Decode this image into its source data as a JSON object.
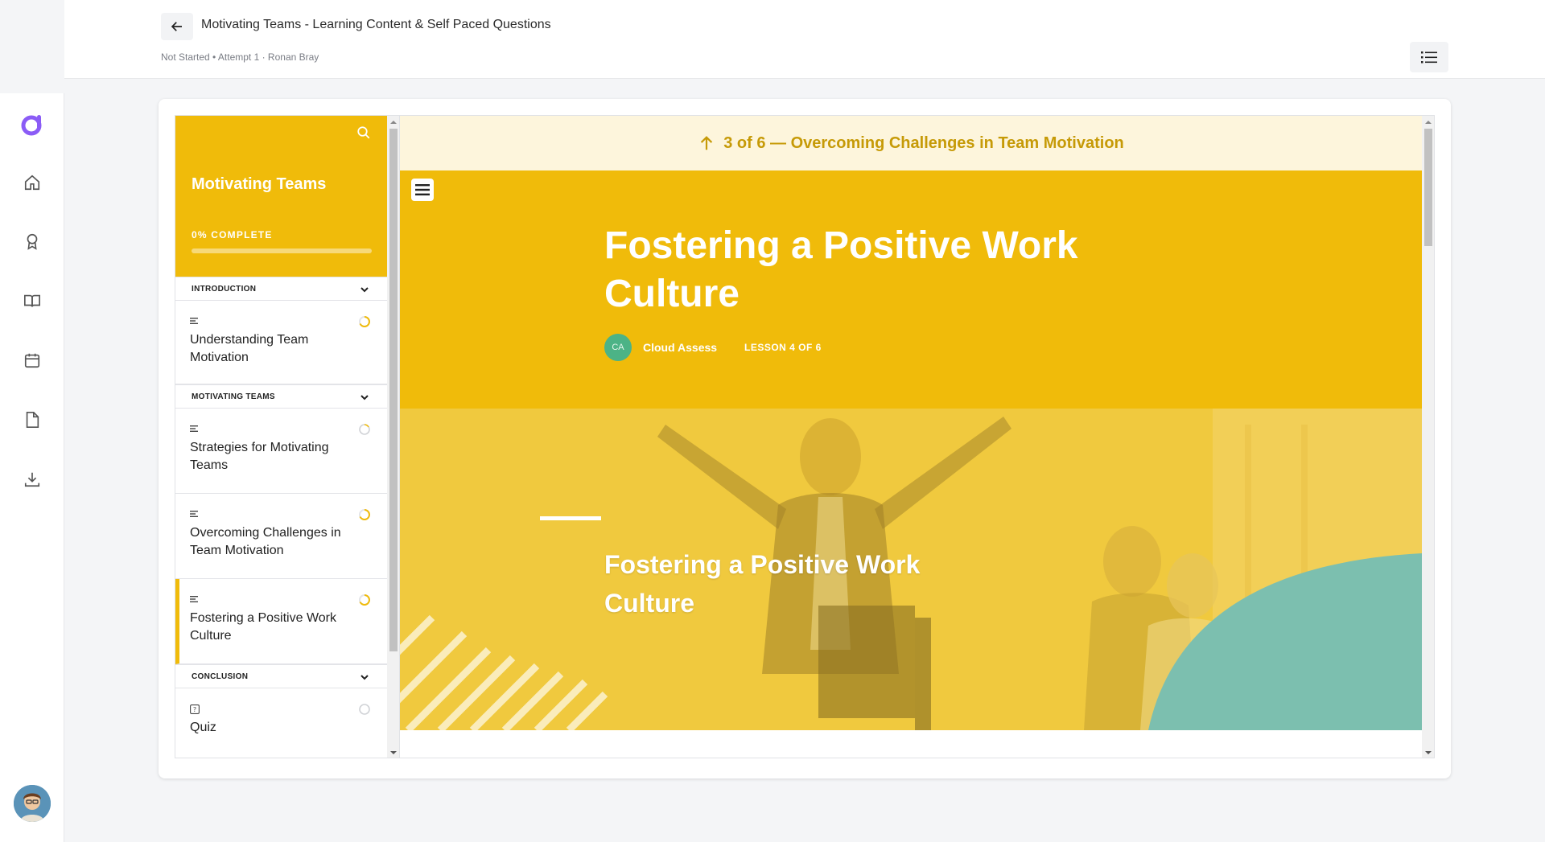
{
  "header": {
    "title": "Motivating Teams - Learning Content & Self Paced Questions",
    "subtitle": "Not Started • Attempt 1 · Ronan Bray"
  },
  "rail": {
    "items": [
      "home-icon",
      "award-icon",
      "book-icon",
      "calendar-icon",
      "document-icon",
      "download-icon"
    ]
  },
  "sidebar": {
    "course_title": "Motivating Teams",
    "progress_label": "0% COMPLETE",
    "progress_value": 0,
    "sections": [
      {
        "label": "INTRODUCTION"
      },
      {
        "label": "MOTIVATING TEAMS"
      },
      {
        "label": "CONCLUSION"
      }
    ],
    "lessons": [
      {
        "title": "Understanding Team Motivation",
        "status": "in-progress"
      },
      {
        "title": "Strategies for Motivating Teams",
        "status": "not-started"
      },
      {
        "title": "Overcoming Challenges in Team Motivation",
        "status": "in-progress"
      },
      {
        "title": "Fostering a Positive Work Culture",
        "status": "in-progress",
        "active": true
      },
      {
        "title": "Quiz",
        "status": "not-started"
      }
    ]
  },
  "content": {
    "prev_lesson": "3 of 6 — Overcoming Challenges in Team Motivation",
    "hero_title": "Fostering a Positive Work Culture",
    "author_initials": "CA",
    "author_name": "Cloud Assess",
    "lesson_count": "LESSON 4 OF 6",
    "banner_title": "Fostering a Positive Work Culture"
  },
  "colors": {
    "accent": "#f0bb0a",
    "accent_dark": "#c69a07",
    "crumb_bg": "#fdf5dc",
    "brand_purple": "#8b5cf6",
    "author_green": "#4cb386",
    "banner_blue": "#5bc0de"
  }
}
